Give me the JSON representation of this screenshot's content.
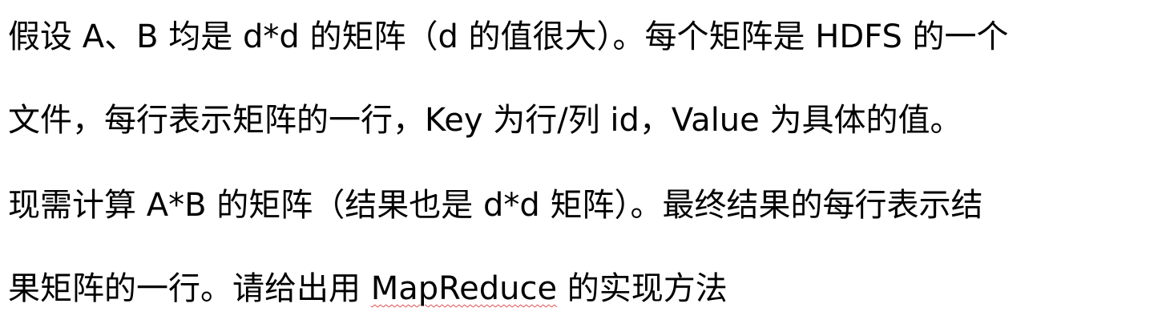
{
  "document": {
    "lines": [
      "假设 A、B 均是 d*d 的矩阵（d 的值很大）。每个矩阵是 HDFS 的一个",
      "文件，每行表示矩阵的一行，Key 为行/列 id，Value 为具体的值。",
      "现需计算 A*B 的矩阵（结果也是 d*d 矩阵）。最终结果的每行表示结",
      "果矩阵的一行。请给出用 ",
      "MapReduce",
      " 的实现方法"
    ]
  }
}
